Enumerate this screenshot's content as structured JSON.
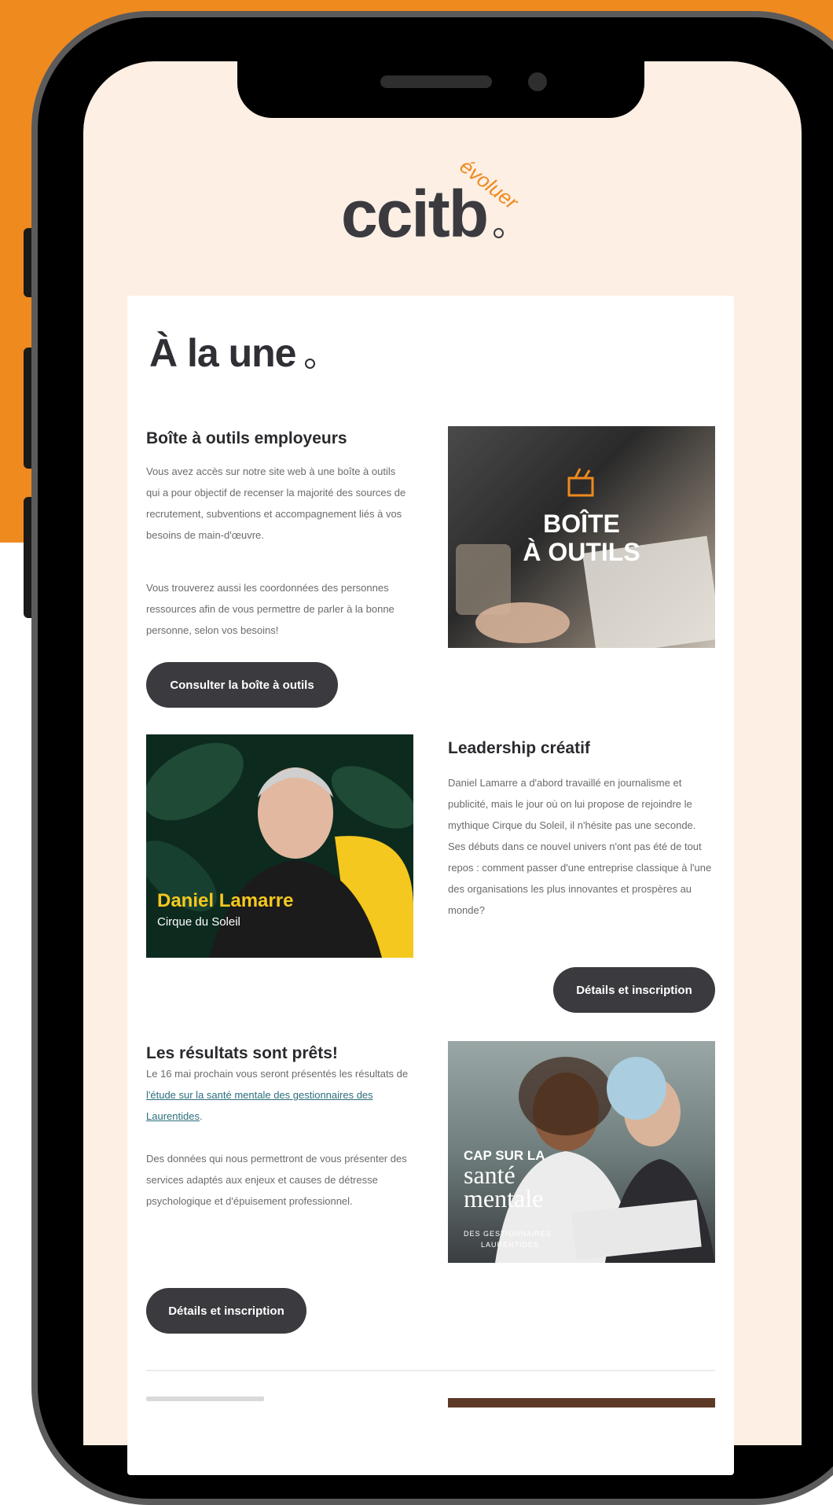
{
  "brand": {
    "logo_text": "ccitb",
    "logo_tagline": "évoluer",
    "orange": "#ef8a1e",
    "dark": "#3a3a3f",
    "screen_bg": "#fdefe4"
  },
  "main": {
    "headline": "À la une"
  },
  "sections": [
    {
      "title": "Boîte à outils employeurs",
      "paragraph1": "Vous avez accès sur notre site web à une boîte à outils qui a pour objectif de recenser la majorité des sources de recrutement, subventions et accompagnement liés à vos besoins de main-d'œuvre.",
      "paragraph2": "Vous trouverez aussi les coordonnées des personnes ressources afin de vous permettre de parler à la bonne personne, selon vos besoins!",
      "button": "Consulter la boîte à outils",
      "image_line1": "BOÎTE",
      "image_line2": "À OUTILS"
    },
    {
      "title": "Leadership créatif",
      "paragraph1": "Daniel Lamarre a d'abord travaillé en journalisme et publicité, mais le jour où on lui propose de rejoindre le mythique Cirque du Soleil, il n'hésite pas une seconde. Ses débuts dans ce nouvel univers n'ont pas été de tout repos : comment passer d'une entreprise classique à l'une des organisations les plus innovantes et prospères au monde?",
      "button": "Détails et inscription",
      "image_name": "Daniel Lamarre",
      "image_subtitle": "Cirque du Soleil"
    },
    {
      "title": "Les résultats sont prêts!",
      "paragraph_intro": "Le 16 mai prochain vous seront présentés les résultats de ",
      "paragraph_link": "l'étude sur la santé mentale des gestionnaires des Laurentides",
      "paragraph_end": ".",
      "paragraph2": "Des données qui nous permettront de vous présenter des services adaptés aux enjeux et causes de détresse psychologique et d'épuisement professionnel.",
      "button": "Détails et inscription",
      "image_line1": "CAP SUR LA",
      "image_line2": "santé",
      "image_line3": "mentale",
      "image_line4": "DES GESTIONNAIRES",
      "image_line5": "LAURENTIDES"
    }
  ]
}
